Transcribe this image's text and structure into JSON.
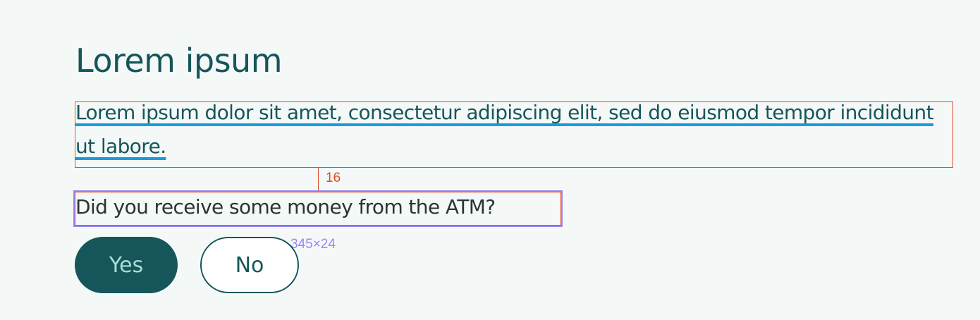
{
  "heading": "Lorem ipsum",
  "intro_text": "Lorem ipsum dolor sit amet, consectetur adipiscing elit, sed do eiusmod tempor incididunt ut labore.",
  "question": "Did you receive some money from the ATM?",
  "annotations": {
    "spacing_value": "16",
    "question_size": "345×24"
  },
  "buttons": {
    "yes_label": "Yes",
    "no_label": "No"
  },
  "colors": {
    "brand": "#16565b",
    "yes_text": "#a8ded0",
    "background": "#f4f9f8",
    "spacing_annotation": "#e04a2a",
    "size_annotation": "#9b87f5",
    "link_underline": "#1a9be0"
  }
}
